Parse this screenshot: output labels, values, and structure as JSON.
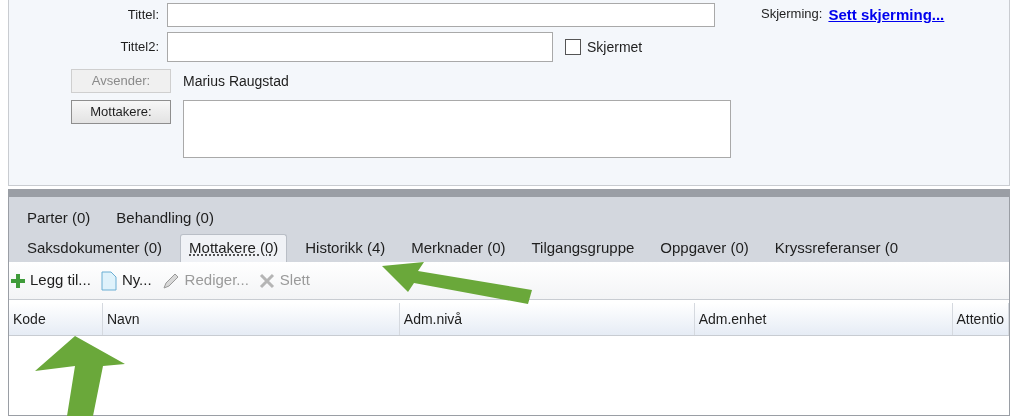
{
  "form": {
    "title_label": "Tittel:",
    "title2_label": "Tittel2:",
    "shielded": {
      "label": "Skjermet",
      "checked": false
    },
    "sender": {
      "button": "Avsender:",
      "disabled": true,
      "value": "Marius Raugstad"
    },
    "recipients": {
      "button": "Mottakere:",
      "disabled": false
    },
    "shielding": {
      "label": "Skjerming:",
      "link": "Sett skjerming..."
    }
  },
  "tab_rows": [
    [
      {
        "label": "Parter (0)",
        "selected": false
      },
      {
        "label": "Behandling (0)",
        "selected": false
      }
    ],
    [
      {
        "label": "Saksdokumenter (0)",
        "selected": false
      },
      {
        "label": "Mottakere (0)",
        "selected": true
      },
      {
        "label": "Historikk (4)",
        "selected": false
      },
      {
        "label": "Merknader (0)",
        "selected": false
      },
      {
        "label": "Tilgangsgruppe",
        "selected": false
      },
      {
        "label": "Oppgaver (0)",
        "selected": false
      },
      {
        "label": "Kryssreferanser (0",
        "selected": false
      }
    ]
  ],
  "toolbar": [
    {
      "kind": "add",
      "label": "Legg til...",
      "disabled": false
    },
    {
      "kind": "new",
      "label": "Ny...",
      "disabled": false
    },
    {
      "kind": "edit",
      "label": "Rediger...",
      "disabled": true
    },
    {
      "kind": "delete",
      "label": "Slett",
      "disabled": true
    }
  ],
  "table": {
    "columns": [
      "Kode",
      "Navn",
      "Adm.nivå",
      "Adm.enhet",
      "Attentio"
    ]
  }
}
